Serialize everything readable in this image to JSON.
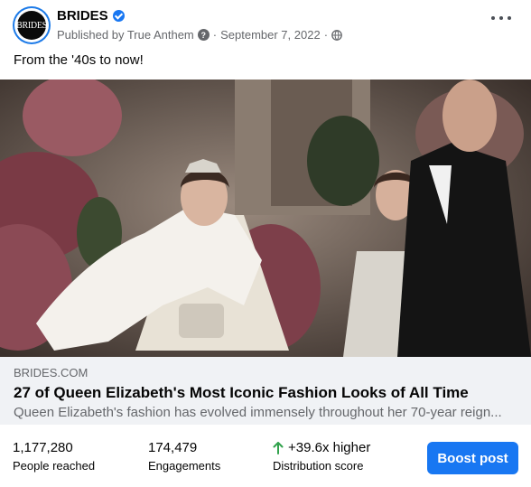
{
  "post": {
    "page_name": "BRIDES",
    "avatar_text": "BRIDES",
    "published_by": "Published by True Anthem",
    "date": "September 7, 2022",
    "separator": "·",
    "caption": "From the '40s to now!"
  },
  "link_preview": {
    "domain": "BRIDES.COM",
    "title": "27 of Queen Elizabeth's Most Iconic Fashion Looks of All Time",
    "description": "Queen Elizabeth's fashion has evolved immensely throughout her 70-year reign..."
  },
  "stats": {
    "reached_value": "1,177,280",
    "reached_label": "People reached",
    "engagements_value": "174,479",
    "engagements_label": "Engagements",
    "distribution_value": "+39.6x higher",
    "distribution_label": "Distribution score"
  },
  "actions": {
    "boost_label": "Boost post"
  },
  "icons": {
    "verified": "verified-badge-icon",
    "help": "question-icon",
    "audience": "globe-icon",
    "more": "more-options-icon",
    "trend": "arrow-up-icon"
  },
  "colors": {
    "brand_blue": "#1877f2",
    "trend_green": "#31a24c",
    "secondary_text": "#65676b",
    "preview_bg": "#f0f2f5"
  }
}
